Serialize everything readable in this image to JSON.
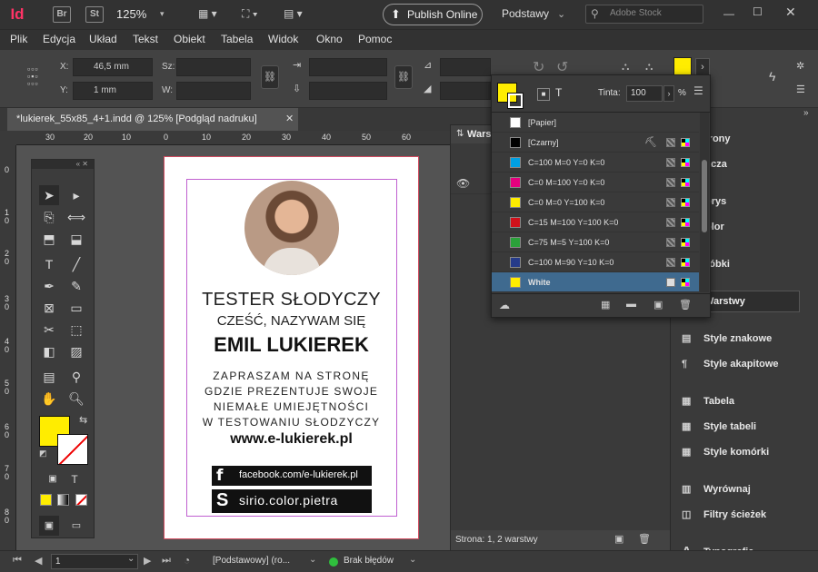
{
  "app": {
    "logo": "Id",
    "br": "Br",
    "st": "St",
    "zoom": "125%",
    "publish": "Publish Online",
    "workspace": "Podstawy",
    "search_placeholder": "Adobe Stock"
  },
  "menu": [
    "Plik",
    "Edycja",
    "Układ",
    "Tekst",
    "Obiekt",
    "Tabela",
    "Widok",
    "Okno",
    "Pomoc"
  ],
  "control": {
    "x_label": "X:",
    "x_value": "46,5 mm",
    "y_label": "Y:",
    "y_value": "1 mm",
    "sz_label": "Sz:",
    "w_label": "W:"
  },
  "document_tab": "*lukierek_55x85_4+1.indd @ 125% [Podgląd nadruku]",
  "ruler_h": [
    "30",
    "20",
    "10",
    "0",
    "10",
    "20",
    "30",
    "40",
    "50",
    "60"
  ],
  "ruler_v": [
    "0",
    "1\n0",
    "2\n0",
    "3\n0",
    "4\n0",
    "5\n0",
    "6\n0",
    "7\n0",
    "8\n0"
  ],
  "card": {
    "line1": "TESTER SŁODYCZY",
    "line2": "CZEŚĆ, NAZYWAM SIĘ",
    "name": "EMIL LUKIEREK",
    "p1": "ZAPRASZAM NA STRONĘ",
    "p2": "GDZIE PREZENTUJE SWOJE",
    "p3": "NIEMAŁE UMIEJĘTNOŚCI",
    "p4": "W TESTOWANIU SŁODZYCZY",
    "web": "www.e-lukierek.pl",
    "fb": "facebook.com/e-lukierek.pl",
    "sirio": "sirio.color.pietra"
  },
  "layers": {
    "tab": "Warst",
    "status": "Strona: 1, 2 warstwy"
  },
  "swatches": {
    "tint_label": "Tinta:",
    "tint_value": "100",
    "percent": "%",
    "rows": [
      {
        "name": "[Papier]",
        "color": "#ffffff"
      },
      {
        "name": "[Czarny]",
        "color": "#000000"
      },
      {
        "name": "C=100 M=0 Y=0 K=0",
        "color": "#00a0e3"
      },
      {
        "name": "C=0 M=100 Y=0 K=0",
        "color": "#e5007e"
      },
      {
        "name": "C=0 M=0 Y=100 K=0",
        "color": "#ffed00"
      },
      {
        "name": "C=15 M=100 Y=100 K=0",
        "color": "#d1101b"
      },
      {
        "name": "C=75 M=5 Y=100 K=0",
        "color": "#2aa13a"
      },
      {
        "name": "C=100 M=90 Y=10 K=0",
        "color": "#263b8a"
      },
      {
        "name": "White",
        "color": "#ffed00"
      }
    ]
  },
  "dock": {
    "stronky": "trony",
    "lacza": "ącza",
    "obrys": "brys",
    "kolor": "olor",
    "probki": "róbki",
    "warstwy": "Warstwy",
    "style_znakowe": "Style znakowe",
    "style_akapitowe": "Style akapitowe",
    "tabela": "Tabela",
    "style_tabeli": "Style tabeli",
    "style_komorki": "Style komórki",
    "wyrownaj": "Wyrównaj",
    "filtry": "Filtry ścieżek",
    "typografia": "Typografia"
  },
  "status": {
    "page": "1",
    "master": "[Podstawowy] (ro...",
    "errors": "Brak błędów"
  },
  "colors": {
    "accent": "#ffed00",
    "page_border": "#d04a5e"
  }
}
